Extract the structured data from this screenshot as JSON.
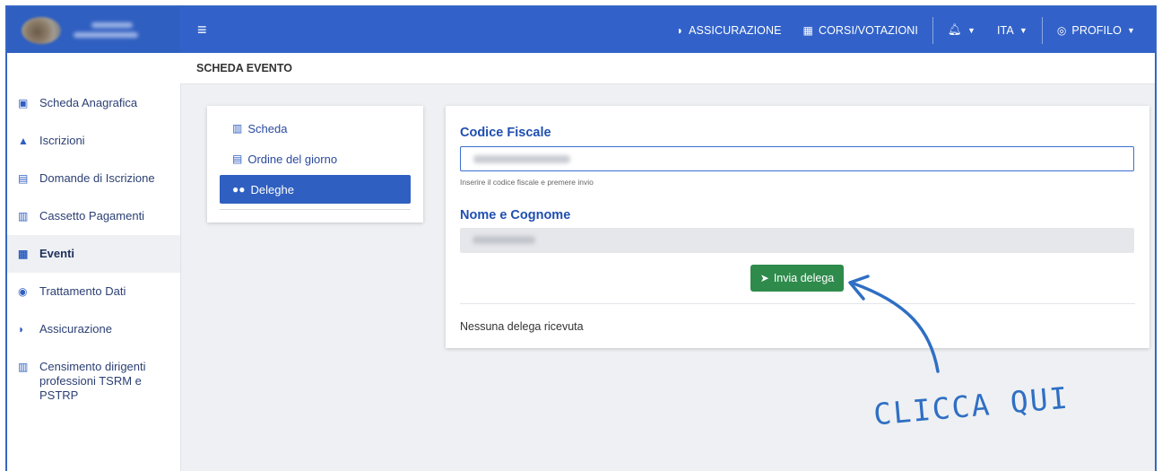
{
  "header": {
    "menu_icon": "hamburger-icon",
    "nav": [
      {
        "label": "ASSICURAZIONE",
        "icon": "shield-icon"
      },
      {
        "label": "CORSI/VOTAZIONI",
        "icon": "classroom-icon"
      },
      {
        "label": "",
        "icon": "bell-icon"
      },
      {
        "label": "ITA"
      },
      {
        "label": "PROFILO",
        "icon": "user-circle-icon"
      }
    ]
  },
  "sidebar": {
    "items": [
      {
        "label": "Scheda Anagrafica",
        "icon": "id-card-icon"
      },
      {
        "label": "Iscrizioni",
        "icon": "user-icon"
      },
      {
        "label": "Domande di Iscrizione",
        "icon": "form-icon"
      },
      {
        "label": "Cassetto Pagamenti",
        "icon": "clipboard-icon"
      },
      {
        "label": "Eventi",
        "icon": "calendar-icon",
        "active": true
      },
      {
        "label": "Trattamento Dati",
        "icon": "eye-icon"
      },
      {
        "label": "Assicurazione",
        "icon": "shield-icon"
      },
      {
        "label": "Censimento dirigenti professioni TSRM e PSTRP",
        "icon": "clipboard-icon"
      }
    ]
  },
  "breadcrumb": "SCHEDA EVENTO",
  "event_nav": [
    {
      "label": "Scheda",
      "icon": "clipboard-icon"
    },
    {
      "label": "Ordine del giorno",
      "icon": "form-icon"
    },
    {
      "label": "Deleghe",
      "icon": "users-icon",
      "active": true
    }
  ],
  "form": {
    "codice_fiscale_label": "Codice Fiscale",
    "codice_fiscale_hint": "Inserire il codice fiscale e premere invio",
    "nome_cognome_label": "Nome e Cognome",
    "send_button": "Invia delega",
    "empty_message": "Nessuna delega ricevuta"
  },
  "annotation": {
    "text": "CLICCA QUI"
  },
  "colors": {
    "primary": "#3262c9",
    "success": "#2e8b4b",
    "annotation": "#2f6fc4"
  }
}
